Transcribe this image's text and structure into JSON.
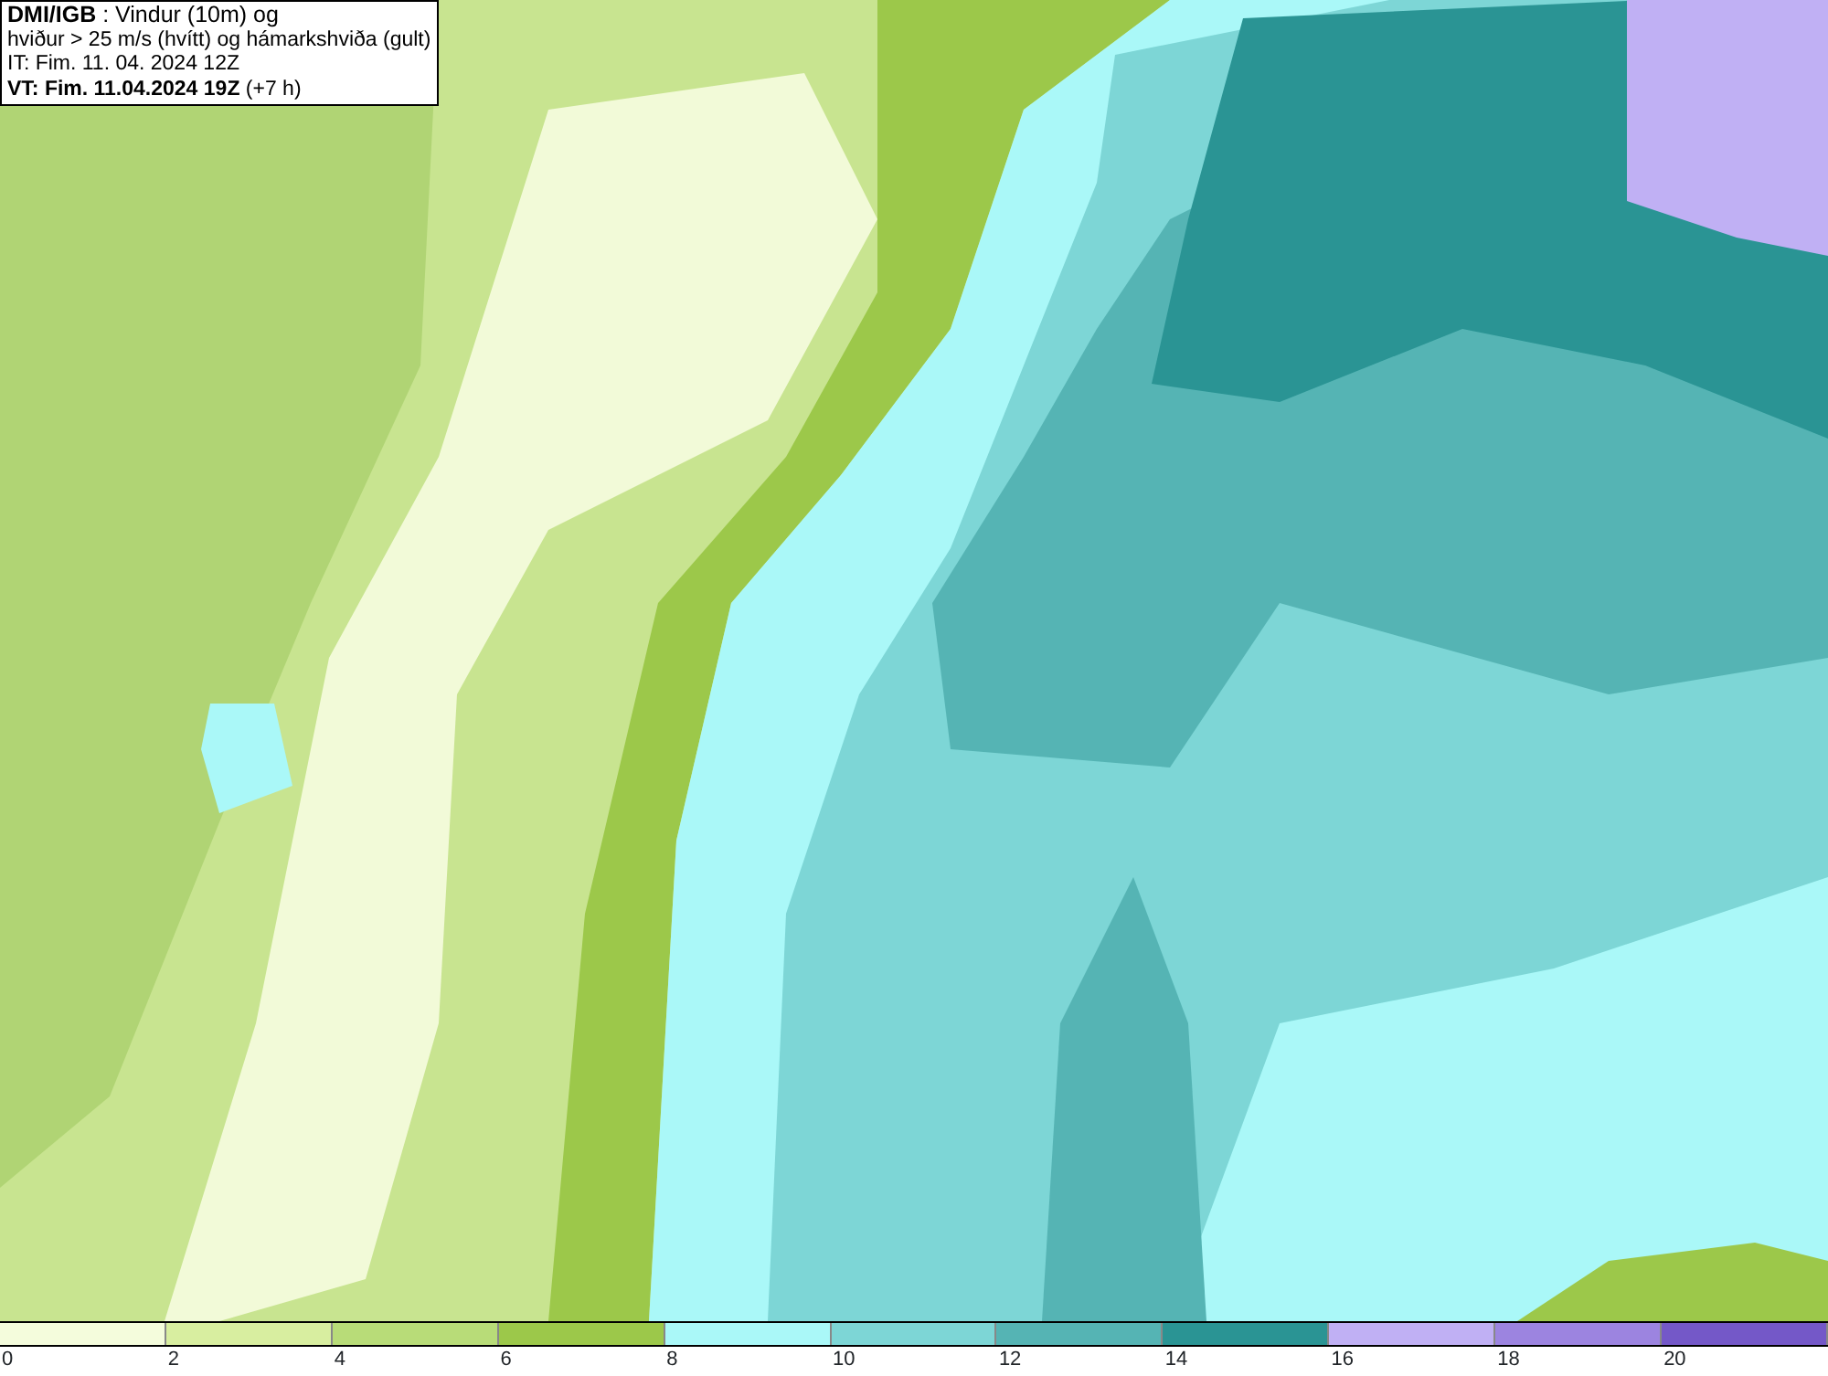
{
  "header": {
    "lines": [
      "**DMI/IGB** : Vindur (10m) og",
      "hviður > 25 m/s (hvítt) og hámarkshviða (gult)",
      "IT: Fim. 11. 04. 2024 12Z",
      "**VT: Fim. 11.04.2024 19Z** (+7 h)"
    ]
  },
  "legend": {
    "segments": [
      {
        "color": "#f4fcdc"
      },
      {
        "color": "#d8eea0"
      },
      {
        "color": "#b8dc78"
      },
      {
        "color": "#9cc84a"
      },
      {
        "color": "#aaf8f8"
      },
      {
        "color": "#7dd6d6"
      },
      {
        "color": "#55b4b4"
      },
      {
        "color": "#2a9494"
      },
      {
        "color": "#c0b0f4"
      },
      {
        "color": "#9c84e0"
      },
      {
        "color": "#7458c8"
      }
    ],
    "ticks": [
      "0",
      "2",
      "4",
      "6",
      "8",
      "10",
      "12",
      "14",
      "16",
      "18",
      "20"
    ]
  }
}
